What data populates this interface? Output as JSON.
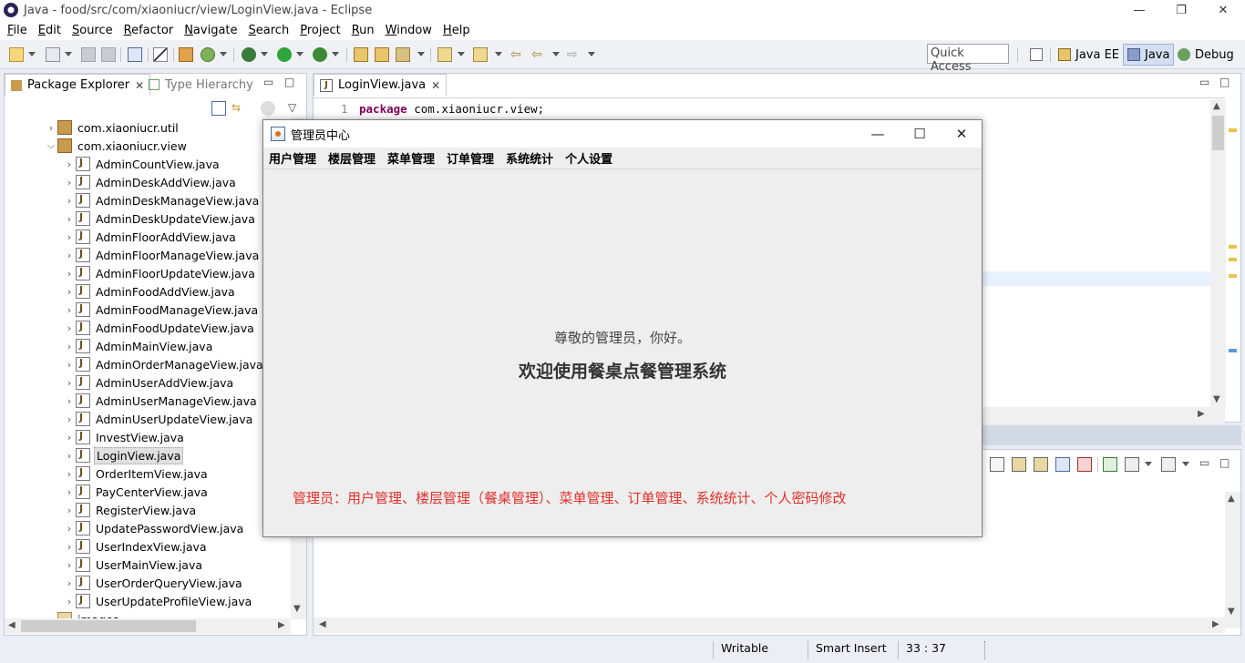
{
  "window": {
    "title": "Java - food/src/com/xiaoniucr/view/LoginView.java - Eclipse",
    "minimize": "—",
    "restore": "❐",
    "close": "✕"
  },
  "menu": [
    "File",
    "Edit",
    "Source",
    "Refactor",
    "Navigate",
    "Search",
    "Project",
    "Run",
    "Window",
    "Help"
  ],
  "toolbar": {
    "quick_access_placeholder": "Quick Access",
    "perspectives": [
      "Java EE",
      "Java",
      "Debug"
    ]
  },
  "explorer": {
    "tab_active": "Package Explorer",
    "tab_inactive": "Type Hierarchy",
    "tree": [
      {
        "label": "com.xiaoniucr.util",
        "type": "package",
        "expanded": false
      },
      {
        "label": "com.xiaoniucr.view",
        "type": "package",
        "expanded": true
      },
      {
        "label": "AdminCountView.java",
        "type": "java"
      },
      {
        "label": "AdminDeskAddView.java",
        "type": "java"
      },
      {
        "label": "AdminDeskManageView.java",
        "type": "java"
      },
      {
        "label": "AdminDeskUpdateView.java",
        "type": "java"
      },
      {
        "label": "AdminFloorAddView.java",
        "type": "java"
      },
      {
        "label": "AdminFloorManageView.java",
        "type": "java"
      },
      {
        "label": "AdminFloorUpdateView.java",
        "type": "java"
      },
      {
        "label": "AdminFoodAddView.java",
        "type": "java"
      },
      {
        "label": "AdminFoodManageView.java",
        "type": "java"
      },
      {
        "label": "AdminFoodUpdateView.java",
        "type": "java"
      },
      {
        "label": "AdminMainView.java",
        "type": "java"
      },
      {
        "label": "AdminOrderManageView.java",
        "type": "java"
      },
      {
        "label": "AdminUserAddView.java",
        "type": "java"
      },
      {
        "label": "AdminUserManageView.java",
        "type": "java"
      },
      {
        "label": "AdminUserUpdateView.java",
        "type": "java"
      },
      {
        "label": "InvestView.java",
        "type": "java"
      },
      {
        "label": "LoginView.java",
        "type": "java",
        "selected": true
      },
      {
        "label": "OrderItemView.java",
        "type": "java"
      },
      {
        "label": "PayCenterView.java",
        "type": "java"
      },
      {
        "label": "RegisterView.java",
        "type": "java"
      },
      {
        "label": "UpdatePasswordView.java",
        "type": "java"
      },
      {
        "label": "UserIndexView.java",
        "type": "java"
      },
      {
        "label": "UserMainView.java",
        "type": "java"
      },
      {
        "label": "UserOrderQueryView.java",
        "type": "java"
      },
      {
        "label": "UserUpdateProfileView.java",
        "type": "java"
      },
      {
        "label": "images",
        "type": "folder"
      }
    ]
  },
  "editor": {
    "tab": "LoginView.java",
    "line_number": "1",
    "keyword": "package",
    "code_rest": " com.xiaoniucr.view;"
  },
  "status": {
    "writable": "Writable",
    "insert_mode": "Smart Insert",
    "position": "33 : 37"
  },
  "dialog": {
    "title": "管理员中心",
    "menus": [
      "用户管理",
      "楼层管理",
      "菜单管理",
      "订单管理",
      "系统统计",
      "个人设置"
    ],
    "greeting": "尊敬的管理员，你好。",
    "welcome": "欢迎使用餐桌点餐管理系统",
    "note": "管理员：用户管理、楼层管理（餐桌管理）、菜单管理、订单管理、系统统计、个人密码修改",
    "note_color": "#e0302a"
  }
}
